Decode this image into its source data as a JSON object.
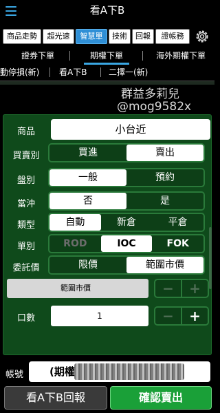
{
  "header": {
    "title": "看A下B"
  },
  "main_tabs": [
    "商品走勢",
    "超光速",
    "智慧單",
    "技術",
    "回報",
    "證帳務"
  ],
  "sub_tabs": [
    "證券下單",
    "期權下單",
    "海外期權下單"
  ],
  "strategy_tabs": [
    "移動停損(新)",
    "看A下B",
    "二擇一(新)"
  ],
  "watermark": {
    "line1": "群益多莉兒",
    "line2": "@mog9582x"
  },
  "form": {
    "product_label": "商品",
    "product_value": "小台近",
    "side_label": "買賣別",
    "side_options": [
      "買進",
      "賣出"
    ],
    "session_label": "盤別",
    "session_options": [
      "一般",
      "預約"
    ],
    "daytrade_label": "當沖",
    "daytrade_options": [
      "否",
      "是"
    ],
    "type_label": "類型",
    "type_options": [
      "自動",
      "新倉",
      "平倉"
    ],
    "order_label": "單別",
    "order_options": [
      "ROD",
      "IOC",
      "FOK"
    ],
    "price_label": "委託價",
    "price_options": [
      "限價",
      "範圍市價"
    ],
    "range_text": "範圍市價",
    "qty_label": "口數",
    "qty_value": "1",
    "minus": "−",
    "plus": "+"
  },
  "account": {
    "label": "帳號",
    "value": "(期權"
  },
  "buttons": {
    "secondary": "看A下B回報",
    "primary": "確認賣出"
  },
  "colors": {
    "accent": "#3aa7e3",
    "panel": "#0f4a1b",
    "confirm": "#1aa038"
  }
}
